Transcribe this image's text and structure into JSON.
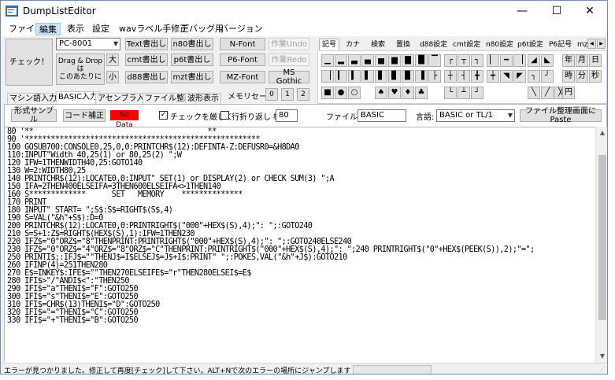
{
  "window": {
    "title": "DumpListEditor",
    "minimize": "—",
    "maximize": "☐",
    "close": "✕"
  },
  "menu": [
    "ファイル",
    "編集",
    "表示",
    "設定",
    "wavラベル手修正",
    "デバッグ用",
    "バージョン"
  ],
  "toolbar": {
    "check": "チェック！",
    "machine_select": "PC-8001",
    "text_write": "Text書出し",
    "n80_write": "n80書出し",
    "nfont": "N-Font",
    "undo": "作業Undo",
    "dragdrop": "Drag & Drop\nは\nこのあたりに",
    "size_large": "大",
    "cmt_write": "cmt書出し",
    "p6t_write": "p6t書出し",
    "p6font": "P6-Font",
    "redo": "作業Redo",
    "size_small": "小",
    "d88_write": "d88書出し",
    "mzt_write": "mzt書出し",
    "mzfont": "MZ-Font",
    "msgothic": "MS Gothic",
    "memo_label": "メモリセーブ:",
    "memo_slots": [
      "0",
      "1",
      "2"
    ]
  },
  "palette": {
    "tabs": [
      "記号",
      "カナ",
      "検索",
      "置換",
      "d88設定",
      "cmt設定",
      "n80設定",
      "p6t設定",
      "P6記号",
      "mz"
    ],
    "nav": [
      "◀",
      "▶"
    ],
    "row1": [
      "▁",
      "▂",
      "▃",
      "▄",
      "▅",
      "▆",
      "▇",
      "█",
      "▔",
      "┌",
      "┬",
      "┐",
      "▏",
      "━",
      "▕",
      "◢",
      "◣",
      "年",
      "月",
      "日"
    ],
    "row2": [
      "▕",
      "▎",
      "▍",
      "▌",
      "▋",
      "▊",
      "▉",
      "▐",
      "├",
      "┼",
      "┤",
      "╋",
      "┿",
      "◥",
      "◤",
      "╮",
      "╯",
      "時",
      "分",
      "秒"
    ],
    "row3": [
      "■",
      "●",
      "○",
      "♠",
      "♥",
      "♦",
      "♣",
      "└",
      "┴",
      "┘",
      "╲",
      "╱",
      "╳",
      "円"
    ]
  },
  "tabs": [
    "マシン語入力",
    "BASIC入力",
    "アセンブラ入力",
    "ファイル整理",
    "波形表示"
  ],
  "panel": {
    "format_sample": "形式サンプル",
    "code_fix": "コード補正",
    "no_data": "No Data",
    "strict_check": "チェックを厳しく",
    "strict_checked": "✓",
    "wrap_label": "行折り返し 桁:",
    "wrap_value": "80",
    "filename_label": "ファイル名:",
    "filename": "BASIC",
    "language_label": "言語:",
    "language": "BASIC or TL/1",
    "paste": "ファイル整理画面にPaste"
  },
  "code": [
    "80 '**                                        **",
    "90 '******************************************************",
    "100 GOSUB700:CONSOLE0,25,0,0:PRINTCHR$(12):DEFINTA-Z:DEFUSR0=&H8DA0",
    "110:INPUT\"Width 40,25(1) or 80,25(2) \";W",
    "120 IFW=1THENWIDTH40,25:GOTO140",
    "130 W=2:WIDTH80,25",
    "140 PRINTCHR$(12):LOCATE0,0:INPUT\" SET(1) or DISPLAY(2) or CHECK SUM(3) \";A",
    "150 IFA=2THEN400ELSEIFA=3THEN600ELSEIFA<>1THEN140",
    "160 S*************      SET   MEMORY    **************",
    "170 PRINT",
    "180 INPUT\" START= \";S$:S$=RIGHT$(S$,4)",
    "190 S=VAL(\"&h\"+S$):D=0",
    "200 PRINTCHR$(12):LOCATE0,0:PRINTRIGHT$(\"000\"+HEX$(S),4);\": \";:GOTO240",
    "210 S=S+1:Z$=RIGHT$(HEX$(S),1):IFW=1THEN230",
    "220 IFZ$=\"0\"ORZ$=\"8\"THENPRINT:PRINTRIGHT$(\"000\"+HEX$(S),4);\": \";:GOTO240ELSE240",
    "230 IFZ$=\"0\"ORZ$=\"4\"ORZ$=\"8\"ORZ$=\"C\"THENPRINT:PRINTRIGHT$(\"000\"+HEX$(S),4);\": \";240 PRINTRIGHT$(\"0\"+HEX$(PEEK(S)),2);\"=\";",
    "250 PRINTI$;:IFJ$=\"\"THENJ$=I$ELSEJ$=J$+I$:PRINT\" \";:POKES,VAL(\"&h\"+J$):GOTO210",
    "260 IFINP(4)=251THEN280",
    "270 E$=INKEY$:IFE$=\"\"THEN270ELSEIFE$=\"r\"THEN280ELSEI$=E$",
    "280 IFI$>\"/\"ANDI$<\":\"THEN250",
    "290 IFI$=\"a\"THENI$=\"F\":GOTO250",
    "300 IFI$=\"s\"THENI$=\"E\":GOTO250",
    "310 IFI$=CHR$(13)THENI$=\"D\":GOTO250",
    "320 IFI$=\"=\"THENI$=\"C\":GOTO250",
    "330 IFI$=\"+\"THENI$=\"B\":GOTO250"
  ],
  "status": "エラーが見つかりました。修正して再度[チェック]して下さい。ALT+Nで次のエラーの場所にジャンプします（ALT-Pで戻ります）。"
}
